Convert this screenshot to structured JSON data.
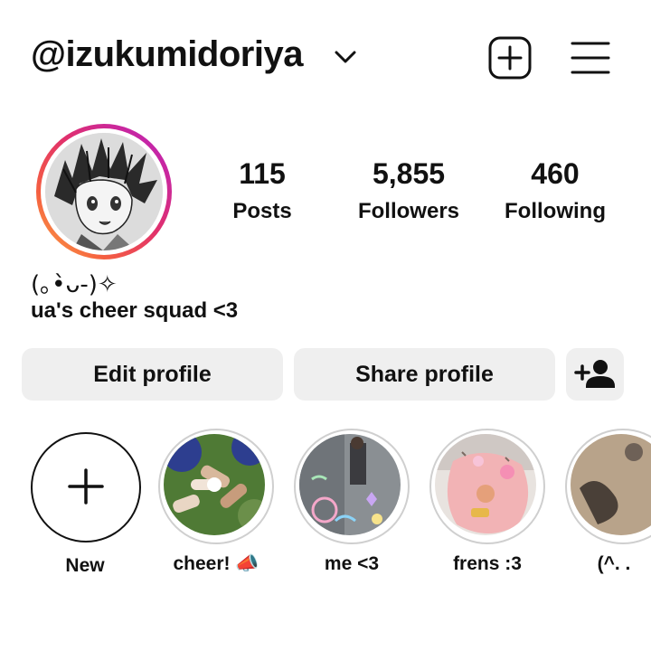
{
  "header": {
    "username": "@izukumidoriya",
    "icons": {
      "dropdown": "chevron-down-icon",
      "create": "plus-square-icon",
      "menu": "hamburger-menu-icon"
    }
  },
  "stats": [
    {
      "value": "115",
      "label": "Posts"
    },
    {
      "value": "5,855",
      "label": "Followers"
    },
    {
      "value": "460",
      "label": "Following"
    }
  ],
  "bio": {
    "line1": "(｡•̀ᴗ-)✧",
    "line2": "ua's cheer squad <3"
  },
  "buttons": {
    "edit": "Edit profile",
    "share": "Share profile",
    "discover_icon": "person-add-icon"
  },
  "highlights": [
    {
      "label": "New"
    },
    {
      "label": "cheer! 📣"
    },
    {
      "label": "me <3"
    },
    {
      "label": "frens :3"
    },
    {
      "label": "(^. ."
    }
  ],
  "colors": {
    "ring_gradient": [
      "#b620c6",
      "#e1306c",
      "#f56040",
      "#fcaf45"
    ],
    "button_bg": "#efefef",
    "text": "#111111"
  }
}
